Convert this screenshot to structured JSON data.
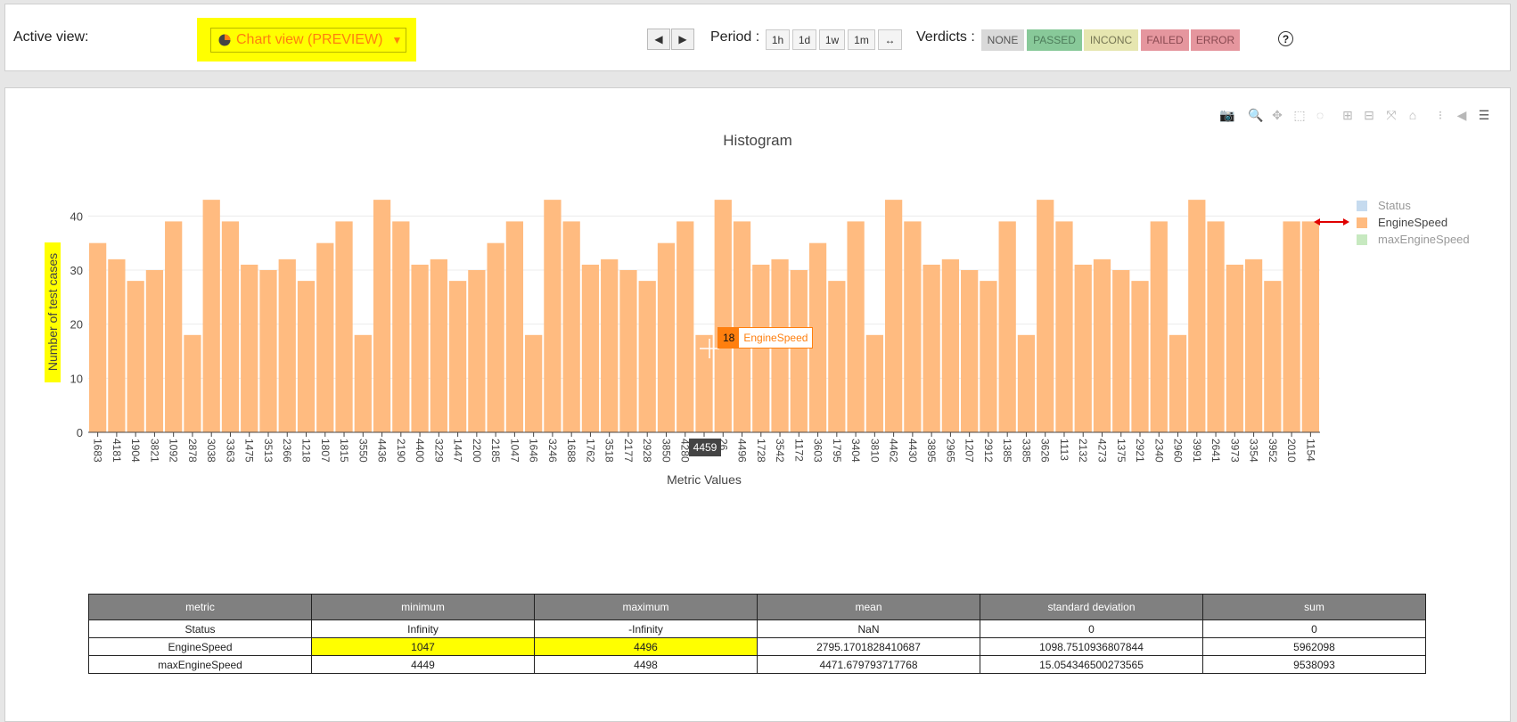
{
  "header": {
    "active_view_label": "Active view:",
    "view_select_value": "Chart view (PREVIEW)",
    "nav_prev": "◀",
    "nav_next": "▶",
    "period_label": "Period :",
    "periods": [
      "1h",
      "1d",
      "1w",
      "1m",
      "↔"
    ],
    "verdicts_label": "Verdicts :",
    "verdicts": [
      {
        "label": "NONE",
        "bg": "#d9d9d9",
        "fg": "#555555"
      },
      {
        "label": "PASSED",
        "bg": "#88c999",
        "fg": "#4d7c5a"
      },
      {
        "label": "INCONC",
        "bg": "#e6e6b0",
        "fg": "#777755"
      },
      {
        "label": "FAILED",
        "bg": "#e5969e",
        "fg": "#8a4a52"
      },
      {
        "label": "ERROR",
        "bg": "#e5969e",
        "fg": "#8a4a52"
      }
    ],
    "help": "?"
  },
  "modebar_icons": [
    "camera-icon",
    "zoom-icon",
    "pan-icon",
    "box-select-icon",
    "lasso-icon",
    "zoom-in-icon",
    "zoom-out-icon",
    "autoscale-icon",
    "reset-axes-icon",
    "spike-lines-icon",
    "hover-closest-icon",
    "hover-compare-icon"
  ],
  "chart_data": {
    "type": "bar",
    "title": "Histogram",
    "xlabel": "Metric Values",
    "ylabel": "Number of test cases",
    "ylim": [
      0,
      45
    ],
    "yticks": [
      0,
      10,
      20,
      30,
      40
    ],
    "grid": true,
    "legend_position": "top-right",
    "categories": [
      "1683",
      "4181",
      "1904",
      "3821",
      "1092",
      "2878",
      "3038",
      "3363",
      "1475",
      "3513",
      "2366",
      "1218",
      "1807",
      "1815",
      "3550",
      "4436",
      "2190",
      "4400",
      "3229",
      "1447",
      "2200",
      "2185",
      "1047",
      "1646",
      "3246",
      "1688",
      "1762",
      "3518",
      "2177",
      "2928",
      "3850",
      "4280",
      "4459",
      "4496",
      "4496",
      "1728",
      "3542",
      "1172",
      "3603",
      "1795",
      "3404",
      "3810",
      "4462",
      "4430",
      "3895",
      "2965",
      "1207",
      "2912",
      "1385",
      "3385",
      "3626",
      "1113",
      "2132",
      "4273",
      "1375",
      "2921",
      "2340",
      "2960",
      "3991",
      "2641",
      "3973",
      "3354",
      "3952",
      "2010",
      "1154"
    ],
    "x_tick_labels": [
      "1683",
      "4181",
      "1904",
      "3821",
      "1092",
      "2878",
      "3038",
      "3363",
      "1475",
      "3513",
      "2366",
      "1218",
      "1807",
      "1815",
      "3550",
      "4436",
      "2190",
      "4400",
      "3229",
      "1447",
      "2200",
      "2185",
      "1047",
      "1646",
      "3246",
      "1688",
      "1762",
      "3518",
      "2177",
      "2928",
      "3850",
      "4280",
      "9",
      "26",
      "4496",
      "1728",
      "3542",
      "1172",
      "3603",
      "1795",
      "3404",
      "3810",
      "4462",
      "4430",
      "3895",
      "2965",
      "1207",
      "2912",
      "1385",
      "3385",
      "3626",
      "1113",
      "2132",
      "4273",
      "1375",
      "2921",
      "2340",
      "2960",
      "3991",
      "2641",
      "3973",
      "3354",
      "3952",
      "2010",
      "1154"
    ],
    "series": [
      {
        "name": "Status",
        "color": "#c6dbef",
        "values": []
      },
      {
        "name": "EngineSpeed",
        "color": "#ffbb80",
        "values": [
          35,
          32,
          28,
          30,
          39,
          18,
          43,
          39,
          31,
          30,
          32,
          28,
          35,
          39,
          18,
          43,
          39,
          31,
          32,
          28,
          30,
          35,
          39,
          18,
          43,
          39,
          31,
          32,
          30,
          28,
          35,
          39,
          18,
          43,
          39,
          31,
          32,
          30,
          35,
          28,
          39,
          18,
          43,
          39,
          31,
          32,
          30,
          28,
          39,
          18,
          43,
          39,
          31,
          32,
          30,
          28,
          39,
          18,
          43,
          39,
          31,
          32,
          28,
          39,
          39
        ]
      },
      {
        "name": "maxEngineSpeed",
        "color": "#c7e9c0",
        "values": []
      }
    ],
    "hover": {
      "value": "18",
      "series": "EngineSpeed",
      "x": "4459"
    }
  },
  "stats_table": {
    "headers": [
      "metric",
      "minimum",
      "maximum",
      "mean",
      "standard deviation",
      "sum"
    ],
    "rows": [
      [
        "Status",
        "Infinity",
        "-Infinity",
        "NaN",
        "0",
        "0"
      ],
      [
        "EngineSpeed",
        "1047",
        "4496",
        "2795.1701828410687",
        "1098.7510936807844",
        "5962098"
      ],
      [
        "maxEngineSpeed",
        "4449",
        "4498",
        "4471.679793717768",
        "15.054346500273565",
        "9538093"
      ]
    ]
  }
}
